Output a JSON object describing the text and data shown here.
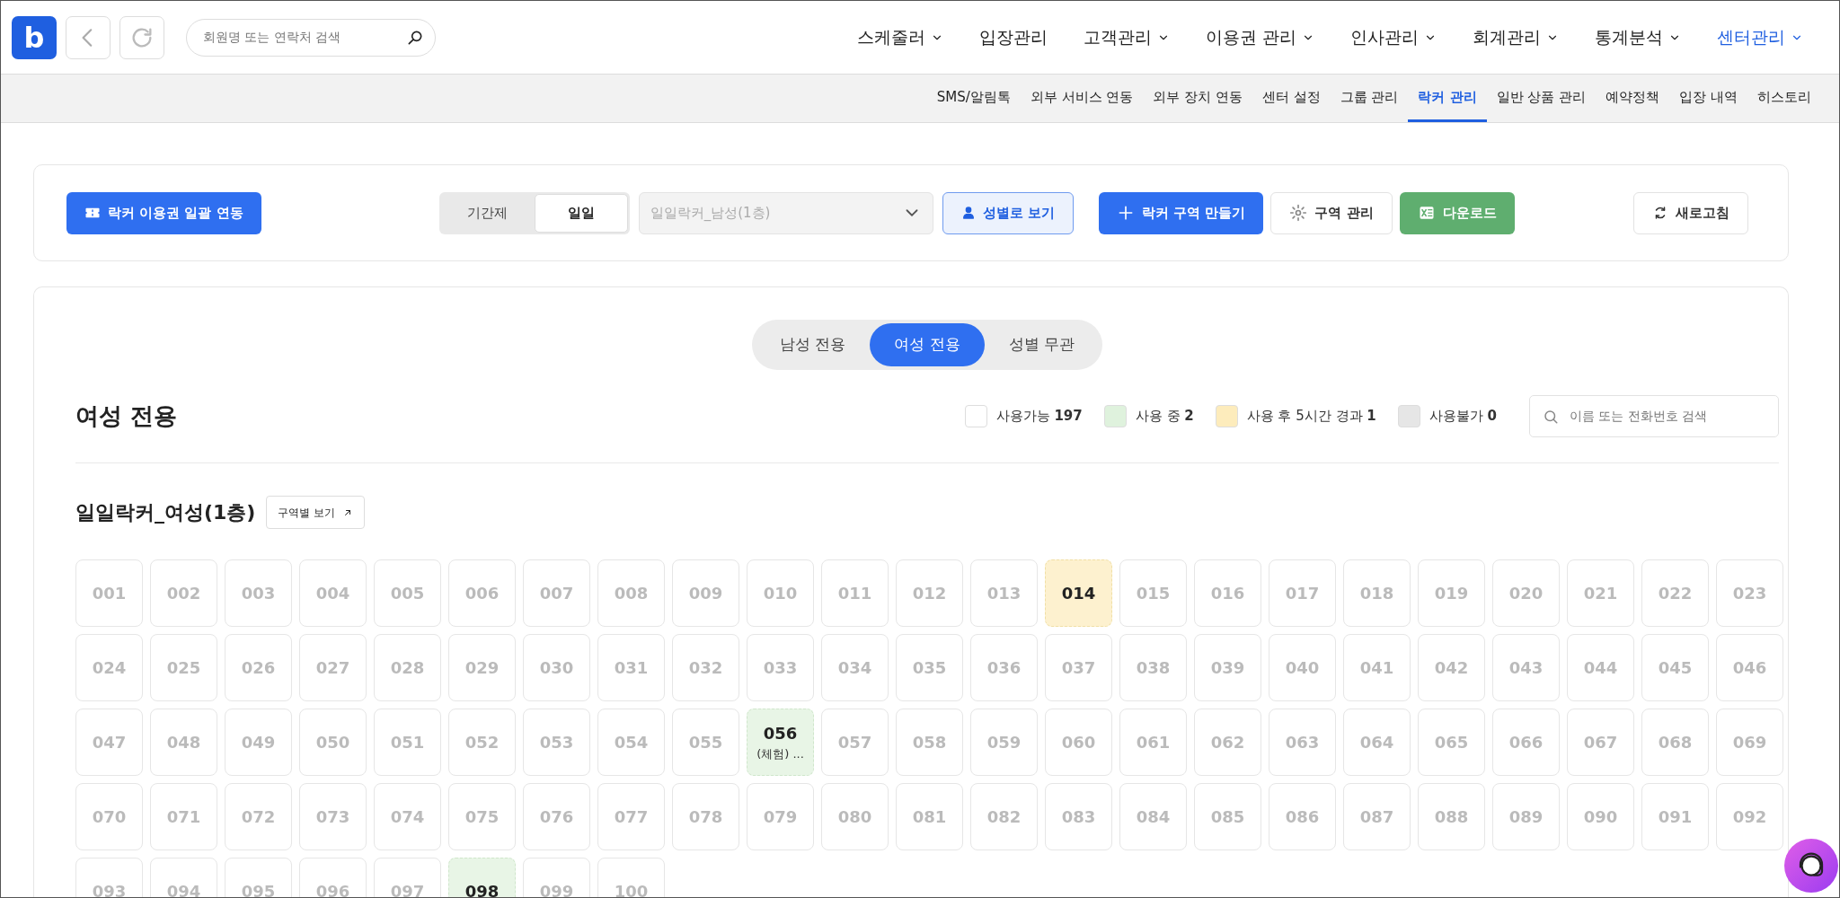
{
  "logo": {
    "letter": "b"
  },
  "search": {
    "placeholder": "회원명 또는 연락처 검색"
  },
  "main_nav": [
    {
      "label": "스케줄러",
      "dropdown": true,
      "selected": false
    },
    {
      "label": "입장관리",
      "dropdown": false,
      "selected": false
    },
    {
      "label": "고객관리",
      "dropdown": true,
      "selected": false
    },
    {
      "label": "이용권 관리",
      "dropdown": true,
      "selected": false
    },
    {
      "label": "인사관리",
      "dropdown": true,
      "selected": false
    },
    {
      "label": "회계관리",
      "dropdown": true,
      "selected": false
    },
    {
      "label": "통계분석",
      "dropdown": true,
      "selected": false
    },
    {
      "label": "센터관리",
      "dropdown": true,
      "selected": true
    }
  ],
  "sub_nav": [
    {
      "label": "SMS/알림톡",
      "selected": false
    },
    {
      "label": "외부 서비스 연동",
      "selected": false
    },
    {
      "label": "외부 장치 연동",
      "selected": false
    },
    {
      "label": "센터 설정",
      "selected": false
    },
    {
      "label": "그룹 관리",
      "selected": false
    },
    {
      "label": "락커 관리",
      "selected": true
    },
    {
      "label": "일반 상품 관리",
      "selected": false
    },
    {
      "label": "예약정책",
      "selected": false
    },
    {
      "label": "입장 내역",
      "selected": false
    },
    {
      "label": "히스토리",
      "selected": false
    }
  ],
  "toolbar": {
    "bulk_link_button": "락커 이용권 일괄 연동",
    "mode_tabs": [
      {
        "label": "기간제",
        "selected": false
      },
      {
        "label": "일일",
        "selected": true
      }
    ],
    "zone_select": {
      "value": "일일락커_남성(1층)",
      "disabled": true
    },
    "gender_view_button": {
      "label": "성별로 보기",
      "on": true
    },
    "create_zone_button": "락커 구역 만들기",
    "zone_manage_button": "구역 관리",
    "download_button": "다운로드",
    "refresh_button": "새로고침"
  },
  "gender_tabs": [
    {
      "label": "남성 전용",
      "selected": false
    },
    {
      "label": "여성 전용",
      "selected": true
    },
    {
      "label": "성별 무관",
      "selected": false
    }
  ],
  "section_title": "여성 전용",
  "legend": [
    {
      "label": "사용가능",
      "count": "197",
      "color": "#ffffff"
    },
    {
      "label": "사용 중",
      "count": "2",
      "color": "#dff2dd"
    },
    {
      "label": "사용 후 5시간 경과",
      "count": "1",
      "color": "#fdecbc"
    },
    {
      "label": "사용불가",
      "count": "0",
      "color": "#e6e6e6"
    }
  ],
  "locker_search": {
    "placeholder": "이름 또는 전화번호 검색"
  },
  "zone": {
    "title": "일일락커_여성(1층)",
    "view_button": "구역별 보기",
    "lockers": [
      {
        "number": "001",
        "kind": "free"
      },
      {
        "number": "002",
        "kind": "free"
      },
      {
        "number": "003",
        "kind": "free"
      },
      {
        "number": "004",
        "kind": "free"
      },
      {
        "number": "005",
        "kind": "free"
      },
      {
        "number": "006",
        "kind": "free"
      },
      {
        "number": "007",
        "kind": "free"
      },
      {
        "number": "008",
        "kind": "free"
      },
      {
        "number": "009",
        "kind": "free"
      },
      {
        "number": "010",
        "kind": "free"
      },
      {
        "number": "011",
        "kind": "free"
      },
      {
        "number": "012",
        "kind": "free"
      },
      {
        "number": "013",
        "kind": "free"
      },
      {
        "number": "014",
        "kind": "expired"
      },
      {
        "number": "015",
        "kind": "free"
      },
      {
        "number": "016",
        "kind": "free"
      },
      {
        "number": "017",
        "kind": "free"
      },
      {
        "number": "018",
        "kind": "free"
      },
      {
        "number": "019",
        "kind": "free"
      },
      {
        "number": "020",
        "kind": "free"
      },
      {
        "number": "021",
        "kind": "free"
      },
      {
        "number": "022",
        "kind": "free"
      },
      {
        "number": "023",
        "kind": "free"
      },
      {
        "number": "024",
        "kind": "free"
      },
      {
        "number": "025",
        "kind": "free"
      },
      {
        "number": "026",
        "kind": "free"
      },
      {
        "number": "027",
        "kind": "free"
      },
      {
        "number": "028",
        "kind": "free"
      },
      {
        "number": "029",
        "kind": "free"
      },
      {
        "number": "030",
        "kind": "free"
      },
      {
        "number": "031",
        "kind": "free"
      },
      {
        "number": "032",
        "kind": "free"
      },
      {
        "number": "033",
        "kind": "free"
      },
      {
        "number": "034",
        "kind": "free"
      },
      {
        "number": "035",
        "kind": "free"
      },
      {
        "number": "036",
        "kind": "free"
      },
      {
        "number": "037",
        "kind": "free"
      },
      {
        "number": "038",
        "kind": "free"
      },
      {
        "number": "039",
        "kind": "free"
      },
      {
        "number": "040",
        "kind": "free"
      },
      {
        "number": "041",
        "kind": "free"
      },
      {
        "number": "042",
        "kind": "free"
      },
      {
        "number": "043",
        "kind": "free"
      },
      {
        "number": "044",
        "kind": "free"
      },
      {
        "number": "045",
        "kind": "free"
      },
      {
        "number": "046",
        "kind": "free"
      },
      {
        "number": "047",
        "kind": "free"
      },
      {
        "number": "048",
        "kind": "free"
      },
      {
        "number": "049",
        "kind": "free"
      },
      {
        "number": "050",
        "kind": "free"
      },
      {
        "number": "051",
        "kind": "free"
      },
      {
        "number": "052",
        "kind": "free"
      },
      {
        "number": "053",
        "kind": "free"
      },
      {
        "number": "054",
        "kind": "free"
      },
      {
        "number": "055",
        "kind": "free"
      },
      {
        "number": "056",
        "kind": "occupied",
        "note": "(체험) ..."
      },
      {
        "number": "057",
        "kind": "free"
      },
      {
        "number": "058",
        "kind": "free"
      },
      {
        "number": "059",
        "kind": "free"
      },
      {
        "number": "060",
        "kind": "free"
      },
      {
        "number": "061",
        "kind": "free"
      },
      {
        "number": "062",
        "kind": "free"
      },
      {
        "number": "063",
        "kind": "free"
      },
      {
        "number": "064",
        "kind": "free"
      },
      {
        "number": "065",
        "kind": "free"
      },
      {
        "number": "066",
        "kind": "free"
      },
      {
        "number": "067",
        "kind": "free"
      },
      {
        "number": "068",
        "kind": "free"
      },
      {
        "number": "069",
        "kind": "free"
      },
      {
        "number": "070",
        "kind": "free"
      },
      {
        "number": "071",
        "kind": "free"
      },
      {
        "number": "072",
        "kind": "free"
      },
      {
        "number": "073",
        "kind": "free"
      },
      {
        "number": "074",
        "kind": "free"
      },
      {
        "number": "075",
        "kind": "free"
      },
      {
        "number": "076",
        "kind": "free"
      },
      {
        "number": "077",
        "kind": "free"
      },
      {
        "number": "078",
        "kind": "free"
      },
      {
        "number": "079",
        "kind": "free"
      },
      {
        "number": "080",
        "kind": "free"
      },
      {
        "number": "081",
        "kind": "free"
      },
      {
        "number": "082",
        "kind": "free"
      },
      {
        "number": "083",
        "kind": "free"
      },
      {
        "number": "084",
        "kind": "free"
      },
      {
        "number": "085",
        "kind": "free"
      },
      {
        "number": "086",
        "kind": "free"
      },
      {
        "number": "087",
        "kind": "free"
      },
      {
        "number": "088",
        "kind": "free"
      },
      {
        "number": "089",
        "kind": "free"
      },
      {
        "number": "090",
        "kind": "free"
      },
      {
        "number": "091",
        "kind": "free"
      },
      {
        "number": "092",
        "kind": "free"
      },
      {
        "number": "093",
        "kind": "free"
      },
      {
        "number": "094",
        "kind": "free"
      },
      {
        "number": "095",
        "kind": "free"
      },
      {
        "number": "096",
        "kind": "free"
      },
      {
        "number": "097",
        "kind": "free"
      },
      {
        "number": "098",
        "kind": "occupied"
      },
      {
        "number": "099",
        "kind": "free"
      },
      {
        "number": "100",
        "kind": "free"
      }
    ]
  }
}
